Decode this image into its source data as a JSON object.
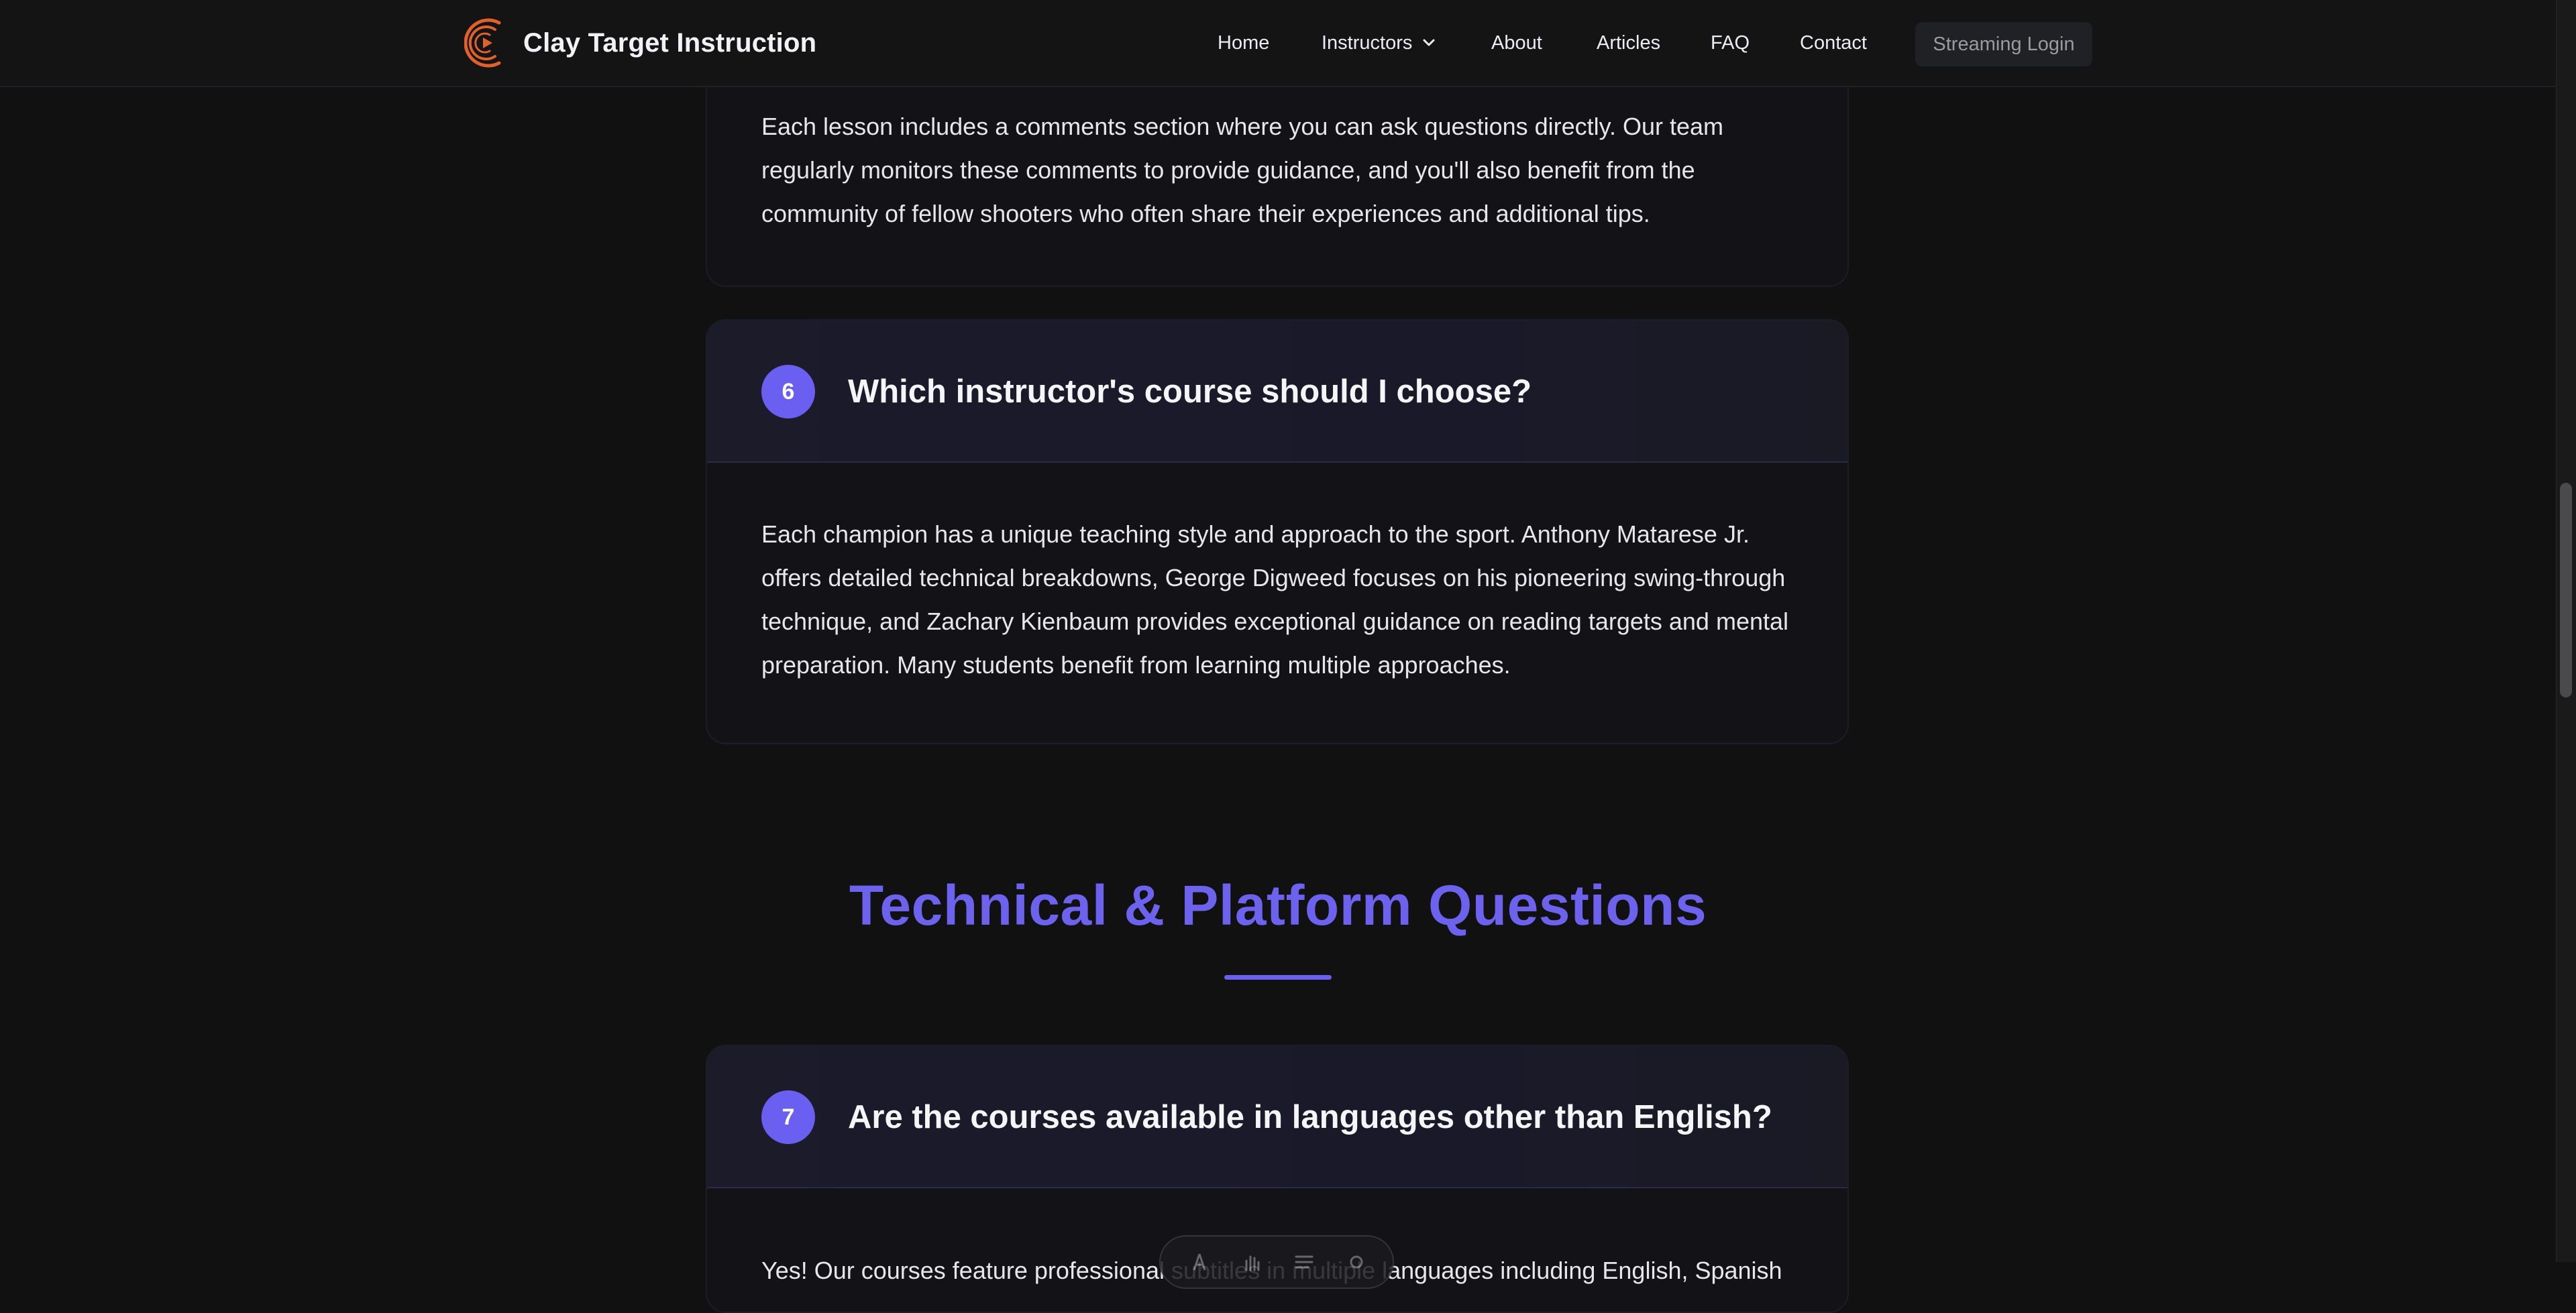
{
  "header": {
    "brand": "Clay Target Instruction",
    "nav": {
      "home": "Home",
      "instructors": "Instructors",
      "about": "About",
      "articles": "Articles",
      "faq": "FAQ",
      "contact": "Contact"
    },
    "login": "Streaming Login"
  },
  "faq": {
    "partial_answer": "Each lesson includes a comments section where you can ask questions directly. Our team regularly monitors these comments to provide guidance, and you'll also benefit from the community of fellow shooters who often share their experiences and additional tips.",
    "q6": {
      "number": "6",
      "question": "Which instructor's course should I choose?",
      "answer": "Each champion has a unique teaching style and approach to the sport. Anthony Matarese Jr. offers detailed technical breakdowns, George Digweed focuses on his pioneering swing-through technique, and Zachary Kienbaum provides exceptional guidance on reading targets and mental preparation. Many students benefit from learning multiple approaches."
    },
    "section_title": "Technical & Platform Questions",
    "q7": {
      "number": "7",
      "question": "Are the courses available in languages other than English?",
      "answer_partial": "Yes! Our courses feature professional subtitles in multiple languages including English, Spanish"
    }
  },
  "icons": {
    "logo": "brand-logo-icon",
    "chevron": "chevron-down-icon"
  },
  "colors": {
    "accent": "#6a5ff0",
    "brand_orange": "#e0612c",
    "background": "#111112"
  }
}
